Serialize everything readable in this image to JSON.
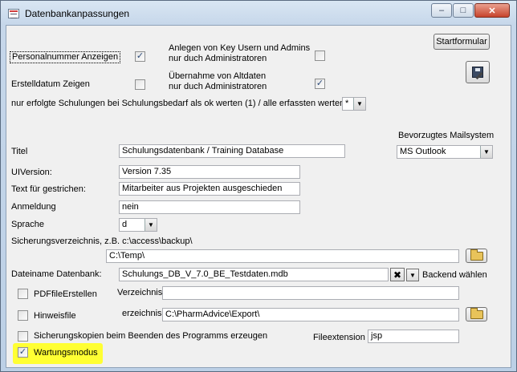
{
  "window": {
    "title": "Datenbankanpassungen",
    "minimize_glyph": "–",
    "maximize_glyph": "□",
    "close_glyph": "✕"
  },
  "top": {
    "personalnummer_label": "Personalnummer Anzeigen",
    "personalnummer_checked": "✓",
    "erstelldatum_label": "Erstelldatum Zeigen",
    "erstelldatum_checked": "",
    "key_users_label_1": "Anlegen von Key Usern und Admins",
    "key_users_label_2": "nur duch Administratoren",
    "key_users_checked": "",
    "altdaten_label_1": "Übernahme von Altdaten",
    "altdaten_label_2": "nur duch Administratoren",
    "altdaten_checked": "✓",
    "schulungen_label": "nur erfolgte Schulungen bei Schulungsbedarf als ok werten (1) / alle erfassten werten (*)",
    "schulungen_value": "*",
    "startformular_label": "Startformular",
    "mailsystem_label": "Bevorzugtes Mailsystem",
    "mailsystem_value": "MS Outlook"
  },
  "fields": {
    "titel_label": "Titel",
    "titel_value": "Schulungsdatenbank / Training Database",
    "uiversion_label": "UIVersion:",
    "uiversion_value": "Version 7.35",
    "gestrichen_label": "Text für gestrichen:",
    "gestrichen_value": "Mitarbeiter aus Projekten ausgeschieden",
    "anmeldung_label": "Anmeldung",
    "anmeldung_value": "nein",
    "sprache_label": "Sprache",
    "sprache_value": "d",
    "sicherung_label": "Sicherungsverzeichnis, z.B. c:\\access\\backup\\",
    "sicherung_value": "C:\\Temp\\",
    "dateiname_label": "Dateiname Datenbank:",
    "dateiname_value": "Schulungs_DB_V_7.0_BE_Testdaten.mdb",
    "backend_label": "Backend wählen"
  },
  "bottom": {
    "pdf_label": "PDFfileErstellen",
    "pdf_checked": "",
    "verzeichnis_label": "Verzeichnis",
    "verzeichnis_value": "",
    "hinweis_label": "Hinweisfile",
    "hinweis_checked": "",
    "hinweis_dir_label": "erzeichnis",
    "hinweis_dir_value": "C:\\PharmAdvice\\Export\\",
    "kopien_label": "Sicherungskopien beim Beenden des Programms erzeugen",
    "kopien_checked": "",
    "fileext_label": "Fileextension",
    "fileext_value": "jsp",
    "wartung_label": "Wartungsmodus",
    "wartung_checked": "✓"
  },
  "glyphs": {
    "dropdown_arrow": "▼",
    "clear_x": "✖"
  },
  "colors": {
    "highlight": "#ffff33",
    "form_background": "#f0f0f0"
  }
}
